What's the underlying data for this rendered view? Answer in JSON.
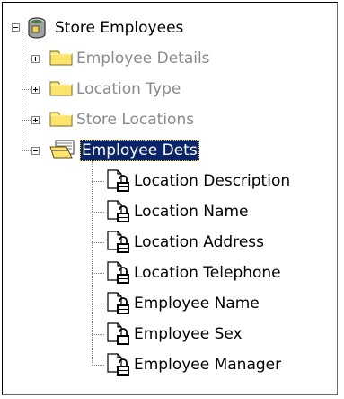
{
  "tree": {
    "root": {
      "label": "Store Employees",
      "icon": "database-icon",
      "expanded": true
    },
    "folders": [
      {
        "label": "Employee Details",
        "icon": "folder-icon",
        "expanded": false,
        "state": "disabled"
      },
      {
        "label": "Location Type",
        "icon": "folder-icon",
        "expanded": false,
        "state": "disabled"
      },
      {
        "label": "Store Locations",
        "icon": "folder-icon",
        "expanded": false,
        "state": "disabled"
      },
      {
        "label": "Employee Dets",
        "icon": "open-folder-icon",
        "expanded": true,
        "state": "selected"
      }
    ],
    "fields": [
      {
        "label": "Location Description",
        "icon": "locked-field-icon"
      },
      {
        "label": "Location Name",
        "icon": "locked-field-icon"
      },
      {
        "label": "Location Address",
        "icon": "locked-field-icon"
      },
      {
        "label": "Location Telephone",
        "icon": "locked-field-icon"
      },
      {
        "label": "Employee Name",
        "icon": "locked-field-icon"
      },
      {
        "label": "Employee Sex",
        "icon": "locked-field-icon"
      },
      {
        "label": "Employee Manager",
        "icon": "locked-field-icon"
      }
    ]
  },
  "colors": {
    "selection": "#0a246a",
    "disabled_text": "#8a8a8a",
    "folder": "#ffe46b"
  }
}
